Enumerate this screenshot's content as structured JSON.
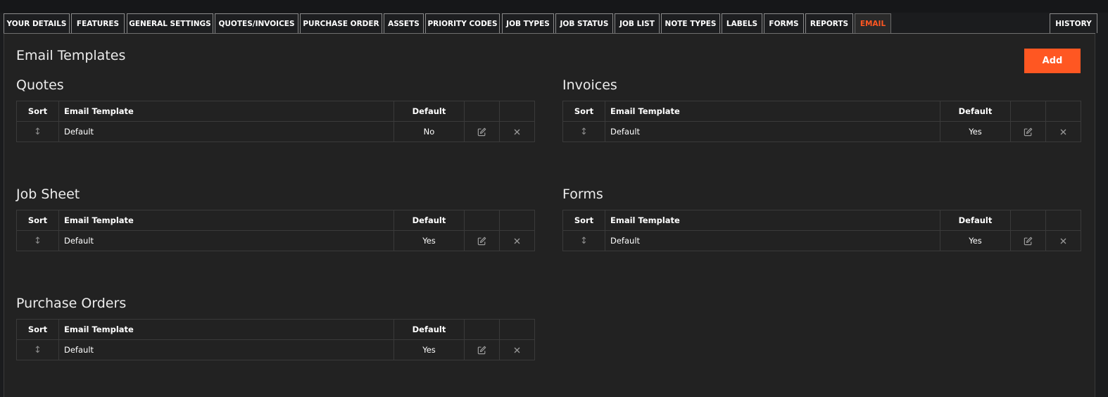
{
  "tabs": [
    {
      "label": "YOUR DETAILS"
    },
    {
      "label": "FEATURES"
    },
    {
      "label": "GENERAL SETTINGS"
    },
    {
      "label": "QUOTES/INVOICES"
    },
    {
      "label": "PURCHASE ORDER"
    },
    {
      "label": "ASSETS"
    },
    {
      "label": "PRIORITY CODES"
    },
    {
      "label": "JOB TYPES"
    },
    {
      "label": "JOB STATUS"
    },
    {
      "label": "JOB LIST"
    },
    {
      "label": "NOTE TYPES"
    },
    {
      "label": "LABELS"
    },
    {
      "label": "FORMS"
    },
    {
      "label": "REPORTS"
    },
    {
      "label": "EMAIL"
    },
    {
      "label": "HISTORY"
    }
  ],
  "active_tab": "EMAIL",
  "page": {
    "title": "Email Templates",
    "add_label": "Add"
  },
  "columns": {
    "sort": "Sort",
    "template": "Email Template",
    "default": "Default"
  },
  "sections": [
    {
      "title": "Quotes",
      "rows": [
        {
          "template": "Default",
          "default": "No"
        }
      ]
    },
    {
      "title": "Invoices",
      "rows": [
        {
          "template": "Default",
          "default": "Yes"
        }
      ]
    },
    {
      "title": "Job Sheet",
      "rows": [
        {
          "template": "Default",
          "default": "Yes"
        }
      ]
    },
    {
      "title": "Forms",
      "rows": [
        {
          "template": "Default",
          "default": "Yes"
        }
      ]
    },
    {
      "title": "Purchase Orders",
      "rows": [
        {
          "template": "Default",
          "default": "Yes"
        }
      ]
    }
  ],
  "colors": {
    "accent": "#ff5722",
    "background": "#222222",
    "border": "#3a3a3a"
  },
  "icons": {
    "sort": "sort-arrows-icon",
    "edit": "edit-icon",
    "delete": "close-icon"
  }
}
